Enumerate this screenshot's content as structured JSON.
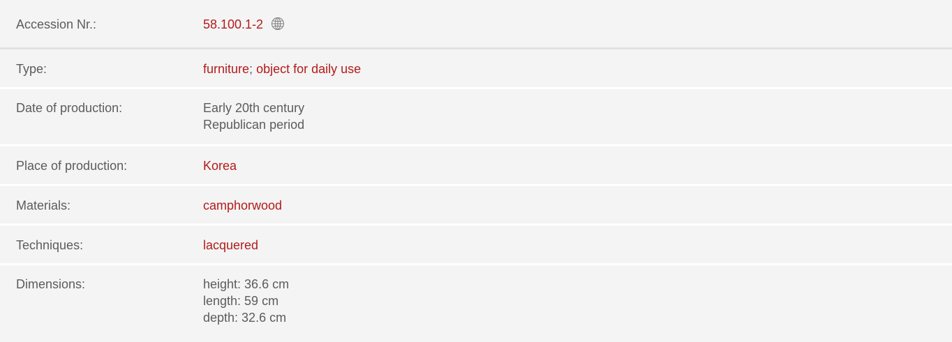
{
  "record": {
    "accession": {
      "label": "Accession Nr.:",
      "value": "58.100.1-2",
      "icon": "globe-icon"
    },
    "type": {
      "label": "Type:",
      "values": [
        "furniture",
        "object for daily use"
      ],
      "separator": ";"
    },
    "date": {
      "label": "Date of production:",
      "lines": [
        "Early 20th century",
        "Republican period"
      ]
    },
    "place": {
      "label": "Place of production:",
      "value": "Korea"
    },
    "materials": {
      "label": "Materials:",
      "value": "camphorwood"
    },
    "techniques": {
      "label": "Techniques:",
      "value": "lacquered"
    },
    "dimensions": {
      "label": "Dimensions:",
      "lines": [
        "height: 36.6 cm",
        "length: 59 cm",
        "depth: 32.6 cm"
      ]
    }
  },
  "colors": {
    "link": "#b31b1b",
    "text": "#5c5c5c",
    "row_background": "#f4f4f4",
    "divider": "#e2e2e2"
  }
}
